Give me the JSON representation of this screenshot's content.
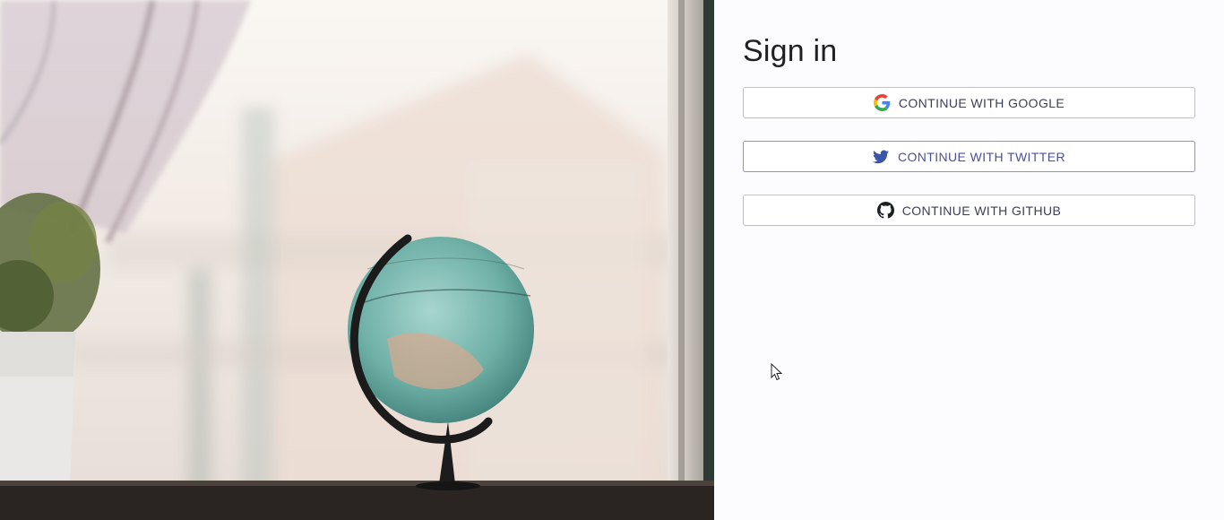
{
  "signin": {
    "title": "Sign in",
    "buttons": {
      "google": "CONTINUE WITH GOOGLE",
      "twitter": "CONTINUE WITH TWITTER",
      "github": "CONTINUE WITH GITHUB"
    }
  },
  "icons": {
    "google": "google-logo-icon",
    "twitter": "twitter-bird-icon",
    "github": "github-octocat-icon",
    "cursor": "mouse-pointer-icon"
  },
  "colors": {
    "panel_background": "#fcfcfe",
    "button_border": "#b9bde0",
    "twitter_text": "#4b4f9a",
    "twitter_blue": "#3d55a8"
  }
}
